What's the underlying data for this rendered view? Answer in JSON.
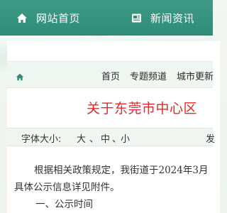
{
  "topnav": {
    "items": [
      {
        "label": "网站首页",
        "icon": "home-icon"
      },
      {
        "label": "新闻资讯",
        "icon": "news-icon"
      }
    ]
  },
  "breadcrumb": {
    "home_icon": "home-icon",
    "links": [
      "首页",
      "专题频道",
      "城市更新"
    ]
  },
  "article": {
    "title": "关于东莞市中心区",
    "font_size_label": "字体大小:",
    "font_sizes": [
      "大",
      "中",
      "小"
    ],
    "font_sep": "、",
    "right_fragment": "发",
    "paragraphs": [
      "根据相关政策规定，我街道于2024年3月",
      "具体公示信息详见附件。",
      "一、公示时间"
    ]
  },
  "colors": {
    "nav_green": "#2f8c76",
    "title_red": "#e02a2a",
    "crumb_icon": "#2f8c76"
  }
}
